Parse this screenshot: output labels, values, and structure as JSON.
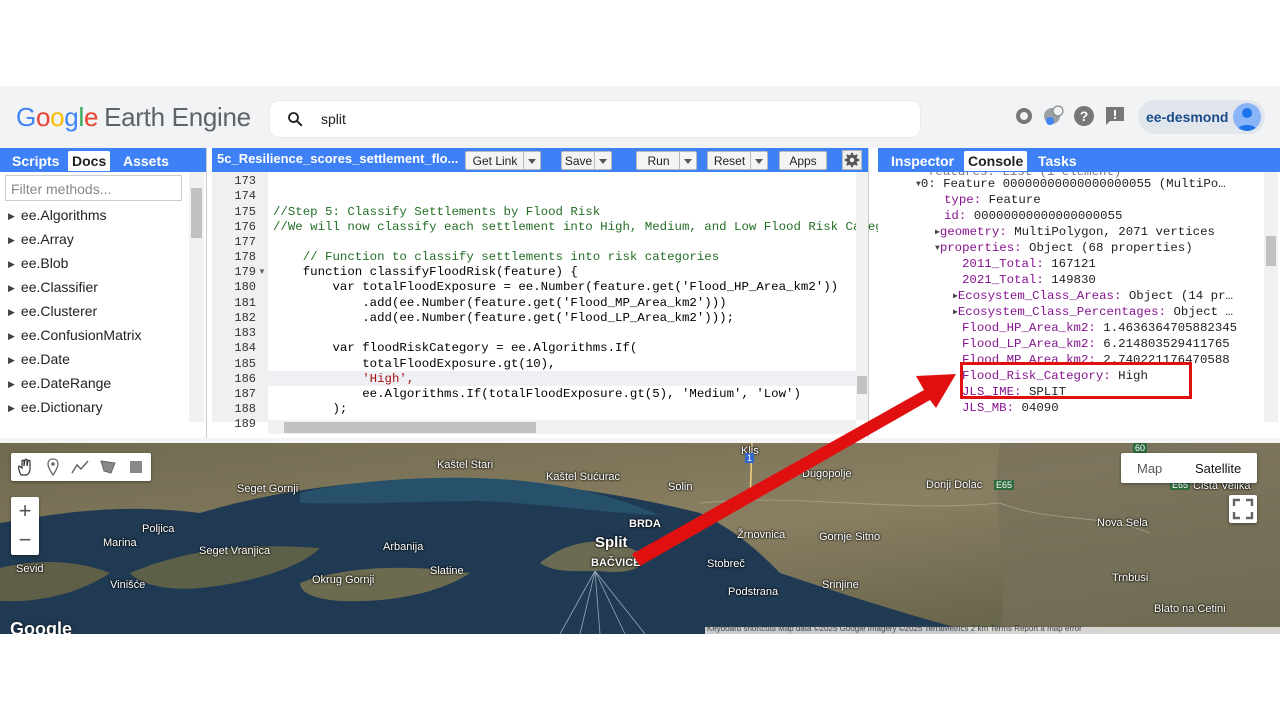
{
  "header": {
    "logo_google": [
      "G",
      "o",
      "o",
      "g",
      "l",
      "e"
    ],
    "logo_rest": "Earth Engine",
    "search_value": "split",
    "user": "ee-desmond"
  },
  "left_panel": {
    "tabs": [
      "Scripts",
      "Docs",
      "Assets"
    ],
    "active_tab": "Docs",
    "filter_placeholder": "Filter methods...",
    "items": [
      "ee.Algorithms",
      "ee.Array",
      "ee.Blob",
      "ee.Classifier",
      "ee.Clusterer",
      "ee.ConfusionMatrix",
      "ee.Date",
      "ee.DateRange",
      "ee.Dictionary"
    ]
  },
  "editor": {
    "title": "5c_Resilience_scores_settlement_flo...",
    "buttons": {
      "get_link": "Get Link",
      "save": "Save",
      "run": "Run",
      "reset": "Reset",
      "apps": "Apps"
    },
    "line_numbers": [
      "173",
      "174",
      "175",
      "176",
      "177",
      "178",
      "179",
      "180",
      "181",
      "182",
      "183",
      "184",
      "185",
      "186",
      "187",
      "188",
      "189"
    ],
    "lines": [
      "",
      "",
      "//Step 5: Classify Settlements by Flood Risk",
      "//We will now classify each settlement into High, Medium, and Low Flood Risk Categ",
      "",
      "    // Function to classify settlements into risk categories",
      "    function classifyFloodRisk(feature) {",
      "        var totalFloodExposure = ee.Number(feature.get('Flood_HP_Area_km2'))",
      "            .add(ee.Number(feature.get('Flood_MP_Area_km2')))",
      "            .add(ee.Number(feature.get('Flood_LP_Area_km2')));",
      "",
      "        var floodRiskCategory = ee.Algorithms.If(",
      "            totalFloodExposure.gt(10),",
      "            'High',",
      "            ee.Algorithms.If(totalFloodExposure.gt(5), 'Medium', 'Low')",
      "        );",
      ""
    ]
  },
  "right_panel": {
    "tabs": [
      "Inspector",
      "Console",
      "Tasks"
    ],
    "active_tab": "Console",
    "console_top_cut": "features: List (1 element)",
    "feature_header": "0: Feature 00000000000000000055 (MultiPo…",
    "type_key": "type:",
    "type_val": "Feature",
    "id_key": "id:",
    "id_val": "00000000000000000055",
    "geometry_key": "geometry:",
    "geometry_val": "MultiPolygon, 2071 vertices",
    "properties_key": "properties:",
    "properties_val": "Object (68 properties)",
    "props": [
      {
        "k": "2011_Total:",
        "v": "167121"
      },
      {
        "k": "2021_Total:",
        "v": "149830"
      },
      {
        "k": "Ecosystem_Class_Areas:",
        "v": "Object (14 pr…"
      },
      {
        "k": "Ecosystem_Class_Percentages:",
        "v": "Object …"
      },
      {
        "k": "Flood_HP_Area_km2:",
        "v": "1.4636364705882345"
      },
      {
        "k": "Flood_LP_Area_km2:",
        "v": "6.214803529411765"
      },
      {
        "k": "Flood_MP_Area_km2:",
        "v": "2.740221176470588"
      },
      {
        "k": "Flood_Risk_Category:",
        "v": "High"
      },
      {
        "k": "JLS_IME:",
        "v": "SPLIT"
      },
      {
        "k": "JLS_MB:",
        "v": "04090"
      }
    ]
  },
  "map": {
    "map_type": [
      "Map",
      "Satellite"
    ],
    "active_type": "Satellite",
    "zoom_in": "+",
    "zoom_out": "−",
    "places": [
      "Kaštel Stari",
      "Kaštel Sućurac",
      "Klis",
      "Seget Gornji",
      "Solin",
      "Dugopolje",
      "Donji Dolac",
      "Cista Velika",
      "Poljica",
      "BRDA",
      "Žrnovnica",
      "Gornje Sitno",
      "Nova Sela",
      "Marina",
      "Seget Vranjica",
      "Arbanija",
      "Split",
      "BAČVICE",
      "Stobreč",
      "Sevid",
      "Slatine",
      "Srinjine",
      "Trnbusi",
      "Vinišće",
      "Okrug Gornji",
      "Podstrana",
      "Blato na Cetini"
    ],
    "road_labels": [
      "60",
      "E65",
      "E65",
      "1"
    ],
    "google": "Google",
    "attribution": "Keyboard shortcuts  Map data ©2025 Google Imagery ©2025 TerraMetrics  2 km  Terms  Report a map error"
  },
  "colors": {
    "accent": "#3e80f6",
    "annotation": "#e01010"
  }
}
